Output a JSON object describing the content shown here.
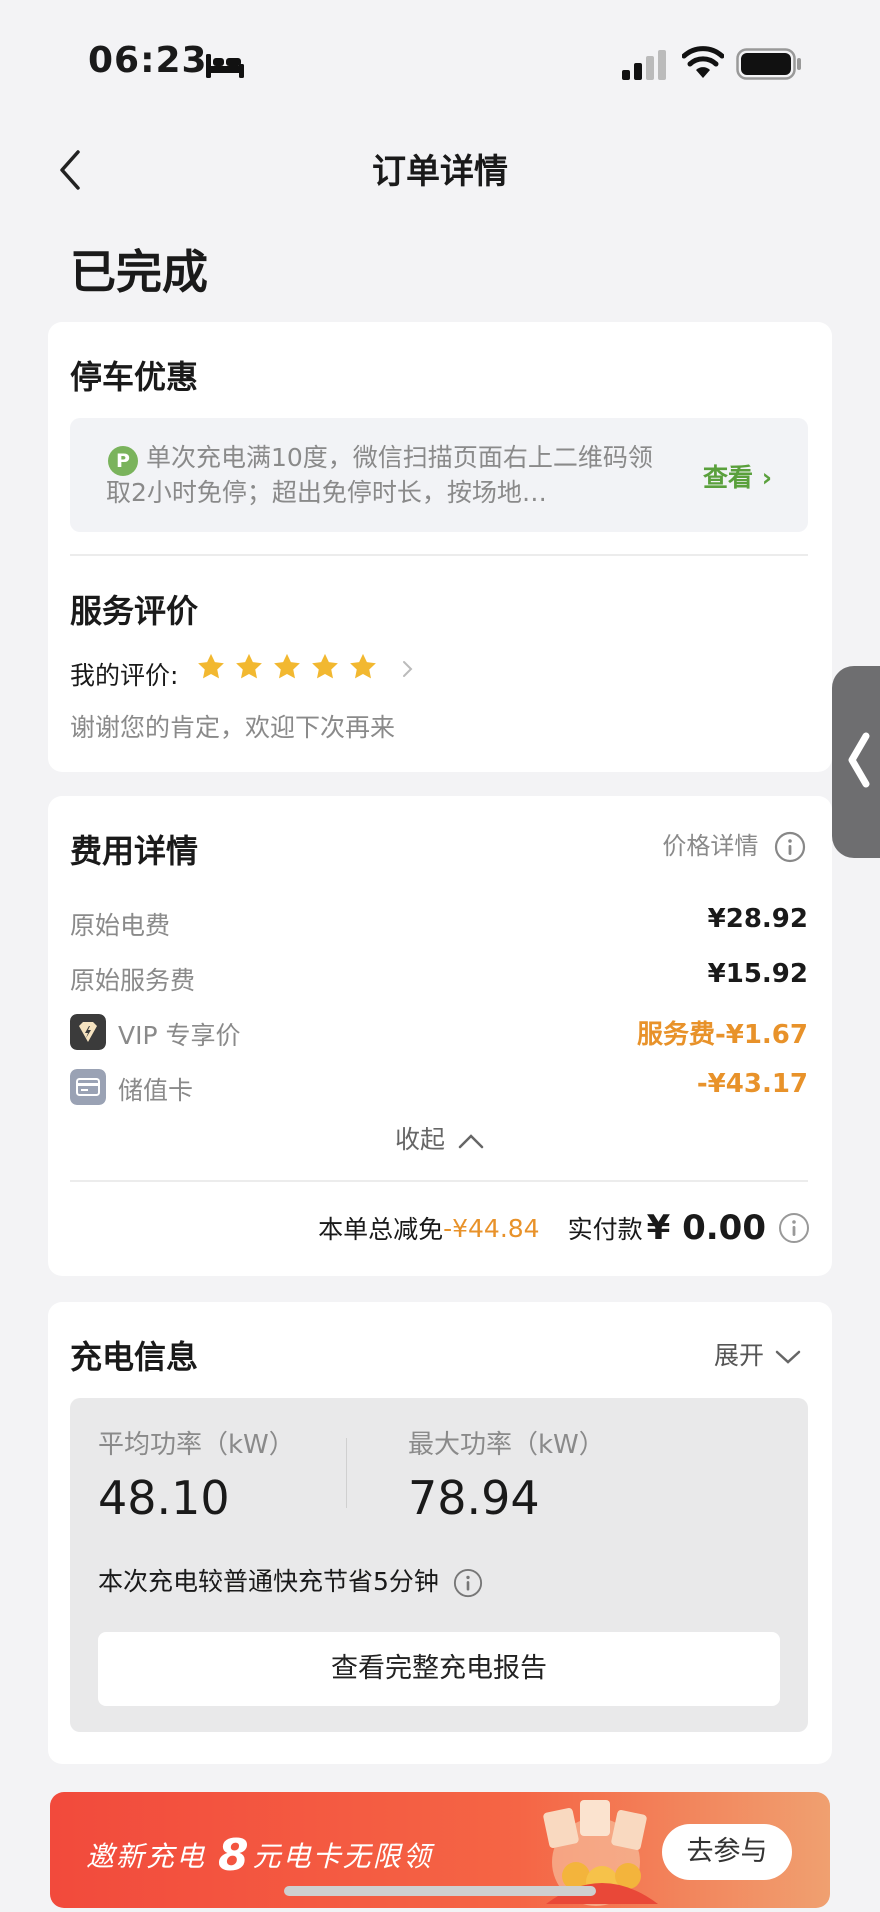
{
  "status_bar": {
    "time": "06:23"
  },
  "header": {
    "title": "订单详情"
  },
  "order_status": "已完成",
  "parking": {
    "title": "停车优惠",
    "badge": "P",
    "text": "单次充电满10度，微信扫描页面右上二维码领取2小时免停；超出免停时长，按场地…",
    "link": "查看 ›"
  },
  "review": {
    "title": "服务评价",
    "label": "我的评价:",
    "stars": 5,
    "message": "谢谢您的肯定，欢迎下次再来"
  },
  "fees": {
    "title": "费用详情",
    "price_detail": "价格详情",
    "items": [
      {
        "label": "原始电费",
        "value": "¥28.92"
      },
      {
        "label": "原始服务费",
        "value": "¥15.92"
      },
      {
        "label": "VIP 专享价",
        "value": "服务费-¥1.67"
      },
      {
        "label": "储值卡",
        "value": "-¥43.17"
      }
    ],
    "collapse": "收起",
    "total_label": "本单总减免",
    "total_value": "-¥44.84",
    "paid_label": "实付款",
    "paid_value": "¥ 0.00",
    "colors": {
      "discount": "#e8922a"
    }
  },
  "charging": {
    "title": "充电信息",
    "expand": "展开",
    "avg_label": "平均功率（kW）",
    "avg_value": "48.10",
    "max_label": "最大功率（kW）",
    "max_value": "78.94",
    "note": "本次充电较普通快充节省5分钟",
    "report_button": "查看完整充电报告"
  },
  "banner": {
    "prefix": "邀新充电",
    "amount": "8",
    "suffix": "元电卡无限领",
    "button": "去参与"
  }
}
